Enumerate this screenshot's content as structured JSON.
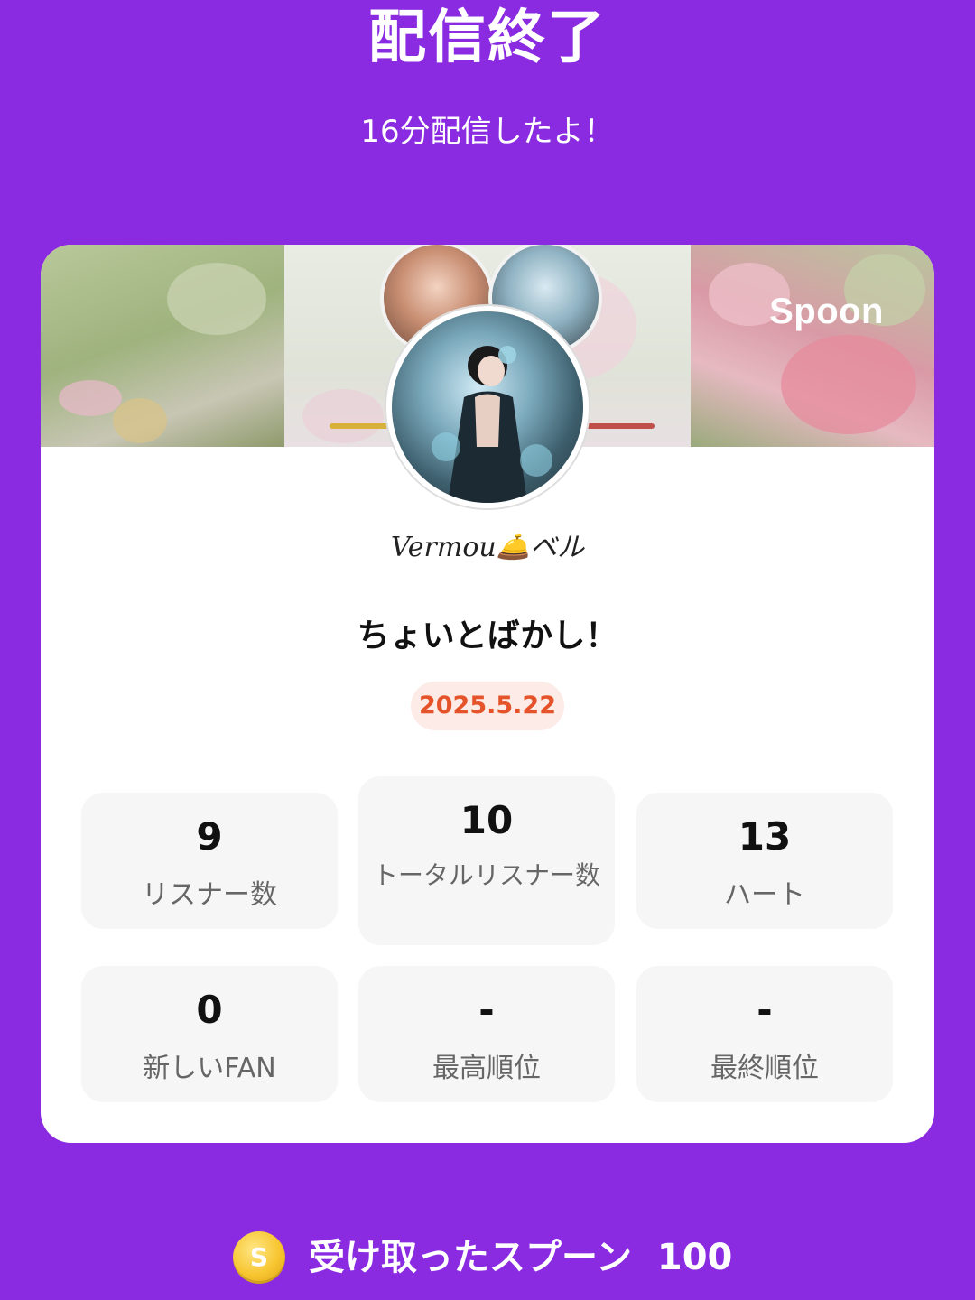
{
  "header": {
    "title": "配信終了",
    "subtitle": "16分配信したよ！"
  },
  "card": {
    "brand_logo": "Spoon",
    "username": "Vermou🛎️ベル",
    "stream_title": "ちょいとばかし！",
    "date": "2025.5.22",
    "stats": [
      {
        "value": "9",
        "label": "リスナー数"
      },
      {
        "value": "10",
        "label": "トータルリスナー数"
      },
      {
        "value": "13",
        "label": "ハート"
      },
      {
        "value": "0",
        "label": "新しいFAN"
      },
      {
        "value": "-",
        "label": "最高順位"
      },
      {
        "value": "-",
        "label": "最終順位"
      }
    ]
  },
  "footer": {
    "coin_icon": "spoon-coin-icon",
    "coin_symbol": "S",
    "label": "受け取ったスプーン",
    "value": "100"
  },
  "colors": {
    "background": "#8a2be2",
    "card": "#ffffff",
    "date_pill_bg": "#fcebe6",
    "date_text": "#e5532a",
    "stat_bg": "#f6f6f6"
  }
}
